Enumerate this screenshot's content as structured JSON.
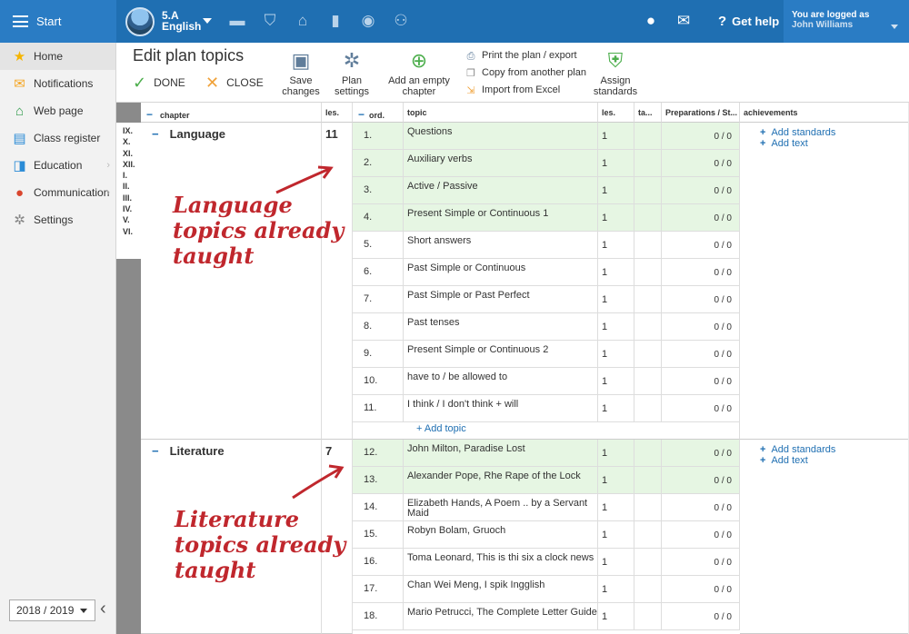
{
  "topbar": {
    "start_label": "Start",
    "class_name": "5.A",
    "subject": "English",
    "help_label": "Get help",
    "logged_as": "You are logged as",
    "user_name": "John Williams"
  },
  "sidebar": {
    "items": [
      {
        "label": "Home",
        "icon": "star-icon"
      },
      {
        "label": "Notifications",
        "icon": "envelope-icon"
      },
      {
        "label": "Web page",
        "icon": "house-icon"
      },
      {
        "label": "Class register",
        "icon": "register-icon"
      },
      {
        "label": "Education",
        "icon": "book-icon"
      },
      {
        "label": "Communication",
        "icon": "chat-icon"
      },
      {
        "label": "Settings",
        "icon": "gear-icon"
      }
    ],
    "year": "2018 / 2019"
  },
  "toolbar": {
    "title": "Edit plan topics",
    "done_label": "DONE",
    "close_label": "CLOSE",
    "save_label": "Save changes",
    "plan_settings_label": "Plan settings",
    "add_chapter_label": "Add an empty chapter",
    "print_label": "Print the plan / export",
    "copy_label": "Copy from another plan",
    "import_label": "Import from Excel",
    "assign_label": "Assign standards"
  },
  "table": {
    "headers": {
      "chapter": "chapter",
      "les1": "les.",
      "ord": "ord.",
      "topic": "topic",
      "les2": "les.",
      "ta": "ta...",
      "prep": "Preparations / St...",
      "achv": "achievements"
    },
    "months": "IX.\nX.\nXI.\nXII.\nI.\nII.\nIII.\nIV.\nV.\nVI.",
    "add_topic": "+ Add topic",
    "add_standards": "Add standards",
    "add_text": "Add text",
    "chapters": [
      {
        "title": "Language",
        "lessons": "11"
      },
      {
        "title": "Literature",
        "lessons": "7"
      }
    ],
    "rows": [
      {
        "ord": "1.",
        "topic": "Questions",
        "les": "1",
        "prep": "0 / 0",
        "done": true
      },
      {
        "ord": "2.",
        "topic": "Auxiliary verbs",
        "les": "1",
        "prep": "0 / 0",
        "done": true
      },
      {
        "ord": "3.",
        "topic": "Active / Passive",
        "les": "1",
        "prep": "0 / 0",
        "done": true
      },
      {
        "ord": "4.",
        "topic": "Present Simple or Continuous 1",
        "les": "1",
        "prep": "0 / 0",
        "done": true
      },
      {
        "ord": "5.",
        "topic": "Short answers",
        "les": "1",
        "prep": "0 / 0",
        "done": false
      },
      {
        "ord": "6.",
        "topic": "Past Simple or Continuous",
        "les": "1",
        "prep": "0 / 0",
        "done": false
      },
      {
        "ord": "7.",
        "topic": "Past Simple or Past Perfect",
        "les": "1",
        "prep": "0 / 0",
        "done": false
      },
      {
        "ord": "8.",
        "topic": "Past tenses",
        "les": "1",
        "prep": "0 / 0",
        "done": false
      },
      {
        "ord": "9.",
        "topic": "Present Simple or Continuous 2",
        "les": "1",
        "prep": "0 / 0",
        "done": false
      },
      {
        "ord": "10.",
        "topic": "have to / be allowed to",
        "les": "1",
        "prep": "0 / 0",
        "done": false
      },
      {
        "ord": "11.",
        "topic": "I think / I don't think + will",
        "les": "1",
        "prep": "0 / 0",
        "done": false
      },
      {
        "ord": "12.",
        "topic": "John Milton, Paradise Lost",
        "les": "1",
        "prep": "0 / 0",
        "done": true
      },
      {
        "ord": "13.",
        "topic": "Alexander Pope, Rhe Rape of the Lock",
        "les": "1",
        "prep": "0 / 0",
        "done": true
      },
      {
        "ord": "14.",
        "topic": "Elizabeth Hands, A Poem .. by a Servant Maid",
        "les": "1",
        "prep": "0 / 0",
        "done": false
      },
      {
        "ord": "15.",
        "topic": "Robyn Bolam, Gruoch",
        "les": "1",
        "prep": "0 / 0",
        "done": false
      },
      {
        "ord": "16.",
        "topic": "Toma Leonard, This is thi six a clock news",
        "les": "1",
        "prep": "0 / 0",
        "done": false
      },
      {
        "ord": "17.",
        "topic": "Chan Wei Meng, I spik Ingglish",
        "les": "1",
        "prep": "0 / 0",
        "done": false
      },
      {
        "ord": "18.",
        "topic": "Mario Petrucci, The Complete Letter Guide",
        "les": "1",
        "prep": "0 / 0",
        "done": false
      }
    ]
  },
  "annotations": {
    "language": "Language\ntopics already\ntaught",
    "literature": "Literature\ntopics already\ntaught",
    "color": "#c0272d"
  }
}
